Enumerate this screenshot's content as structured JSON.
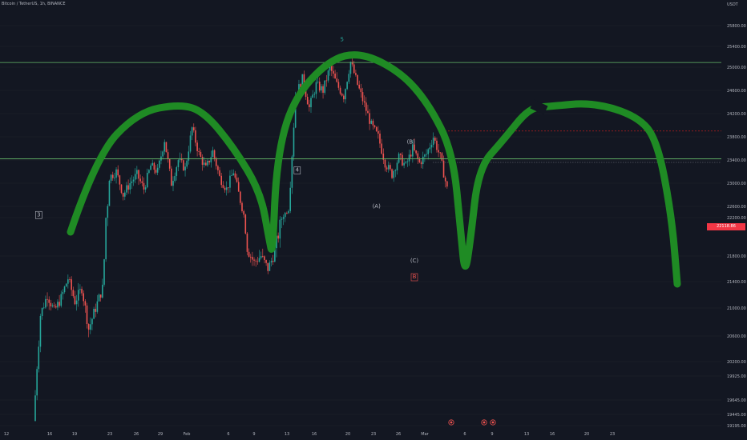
{
  "header": {
    "title": "Bitcoin / TetherUS, 1h, BINANCE"
  },
  "price_axis": {
    "currency": "USDT",
    "price_tag": "22118.86",
    "price_tag_color": "#f23645"
  },
  "colors": {
    "up": "#26a69a",
    "down": "#ef5350",
    "curve": "#1f8b24",
    "hline": "#66bb6a",
    "resistance": "#b71c1c",
    "label_green": "#26a69a",
    "label_red": "#ef5350"
  },
  "chart_data": {
    "type": "candlestick",
    "title": "Bitcoin / TetherUS, 1h, BINANCE",
    "y_ticks": [
      25800,
      25400,
      25000,
      24600,
      24200,
      23800,
      23400,
      23000,
      22600,
      22200,
      21800,
      21400,
      21000,
      20600,
      20200,
      19925,
      19645,
      19445,
      19195
    ],
    "x_ticks": [
      "12",
      "16",
      "19",
      "23",
      "26",
      "29",
      "Feb",
      "6",
      "9",
      "13",
      "16",
      "20",
      "23",
      "26",
      "Mar",
      "6",
      "9",
      "13",
      "16",
      "20",
      "23"
    ],
    "ohlc_path": [
      [
        0,
        19300
      ],
      [
        2,
        20900
      ],
      [
        4,
        21200
      ],
      [
        6,
        20950
      ],
      [
        8,
        21150
      ],
      [
        10,
        21450
      ],
      [
        12,
        21100
      ],
      [
        14,
        21300
      ],
      [
        16,
        20700
      ],
      [
        18,
        21000
      ],
      [
        20,
        21300
      ],
      [
        22,
        23100
      ],
      [
        24,
        23200
      ],
      [
        26,
        22800
      ],
      [
        28,
        23000
      ],
      [
        30,
        23150
      ],
      [
        32,
        22900
      ],
      [
        34,
        23300
      ],
      [
        36,
        23200
      ],
      [
        38,
        23750
      ],
      [
        40,
        23000
      ],
      [
        42,
        23400
      ],
      [
        44,
        23250
      ],
      [
        46,
        23950
      ],
      [
        48,
        23500
      ],
      [
        50,
        23250
      ],
      [
        52,
        23550
      ],
      [
        54,
        23100
      ],
      [
        56,
        22900
      ],
      [
        58,
        23200
      ],
      [
        60,
        22700
      ],
      [
        62,
        21900
      ],
      [
        64,
        21700
      ],
      [
        66,
        21800
      ],
      [
        68,
        21600
      ],
      [
        70,
        21850
      ],
      [
        72,
        22200
      ],
      [
        74,
        22500
      ],
      [
        76,
        24500
      ],
      [
        78,
        24800
      ],
      [
        80,
        24300
      ],
      [
        82,
        24700
      ],
      [
        84,
        24600
      ],
      [
        86,
        25000
      ],
      [
        88,
        24700
      ],
      [
        90,
        24500
      ],
      [
        92,
        25100
      ],
      [
        94,
        24700
      ],
      [
        96,
        24350
      ],
      [
        98,
        24000
      ],
      [
        100,
        23800
      ],
      [
        102,
        23350
      ],
      [
        104,
        23150
      ],
      [
        106,
        23450
      ],
      [
        108,
        23300
      ],
      [
        110,
        23600
      ],
      [
        112,
        23350
      ],
      [
        114,
        23500
      ],
      [
        116,
        23800
      ],
      [
        118,
        23450
      ],
      [
        120,
        22900
      ]
    ],
    "horizontal_lines": [
      25090,
      23420
    ],
    "resistance_line": 23900,
    "current_price_line": 23400,
    "curve_overlay": [
      [
        88,
        290
      ],
      [
        120,
        195
      ],
      [
        172,
        140
      ],
      [
        225,
        130
      ],
      [
        255,
        140
      ],
      [
        292,
        185
      ],
      [
        325,
        240
      ],
      [
        336,
        300
      ],
      [
        340,
        320
      ],
      [
        345,
        200
      ],
      [
        365,
        125
      ],
      [
        410,
        75
      ],
      [
        450,
        65
      ],
      [
        500,
        90
      ],
      [
        535,
        130
      ],
      [
        565,
        190
      ],
      [
        575,
        290
      ],
      [
        580,
        345
      ],
      [
        587,
        300
      ],
      [
        597,
        210
      ],
      [
        628,
        175
      ],
      [
        660,
        135
      ],
      [
        685,
        133
      ],
      [
        740,
        128
      ],
      [
        795,
        145
      ],
      [
        820,
        175
      ],
      [
        838,
        270
      ],
      [
        845,
        355
      ]
    ],
    "wave_labels": [
      {
        "text": "3",
        "price": 22250,
        "index": 1,
        "boxed": true,
        "color": "#b2b5be"
      },
      {
        "text": "5",
        "price": 25500,
        "index": 89,
        "boxed": false,
        "color": "#26a69a"
      },
      {
        "text": "4",
        "price": 23200,
        "index": 76,
        "boxed": true,
        "color": "#b2b5be"
      },
      {
        "text": "(A)",
        "price": 22550,
        "index": 99,
        "boxed": false,
        "color": "#b2b5be"
      },
      {
        "text": "(B)",
        "price": 23680,
        "index": 109,
        "boxed": false,
        "color": "#b2b5be"
      },
      {
        "text": "(C)",
        "price": 21700,
        "index": 110,
        "boxed": false,
        "color": "#b2b5be"
      },
      {
        "text": "B",
        "price": 21450,
        "index": 110,
        "boxed": true,
        "color": "#ef5350"
      }
    ]
  }
}
